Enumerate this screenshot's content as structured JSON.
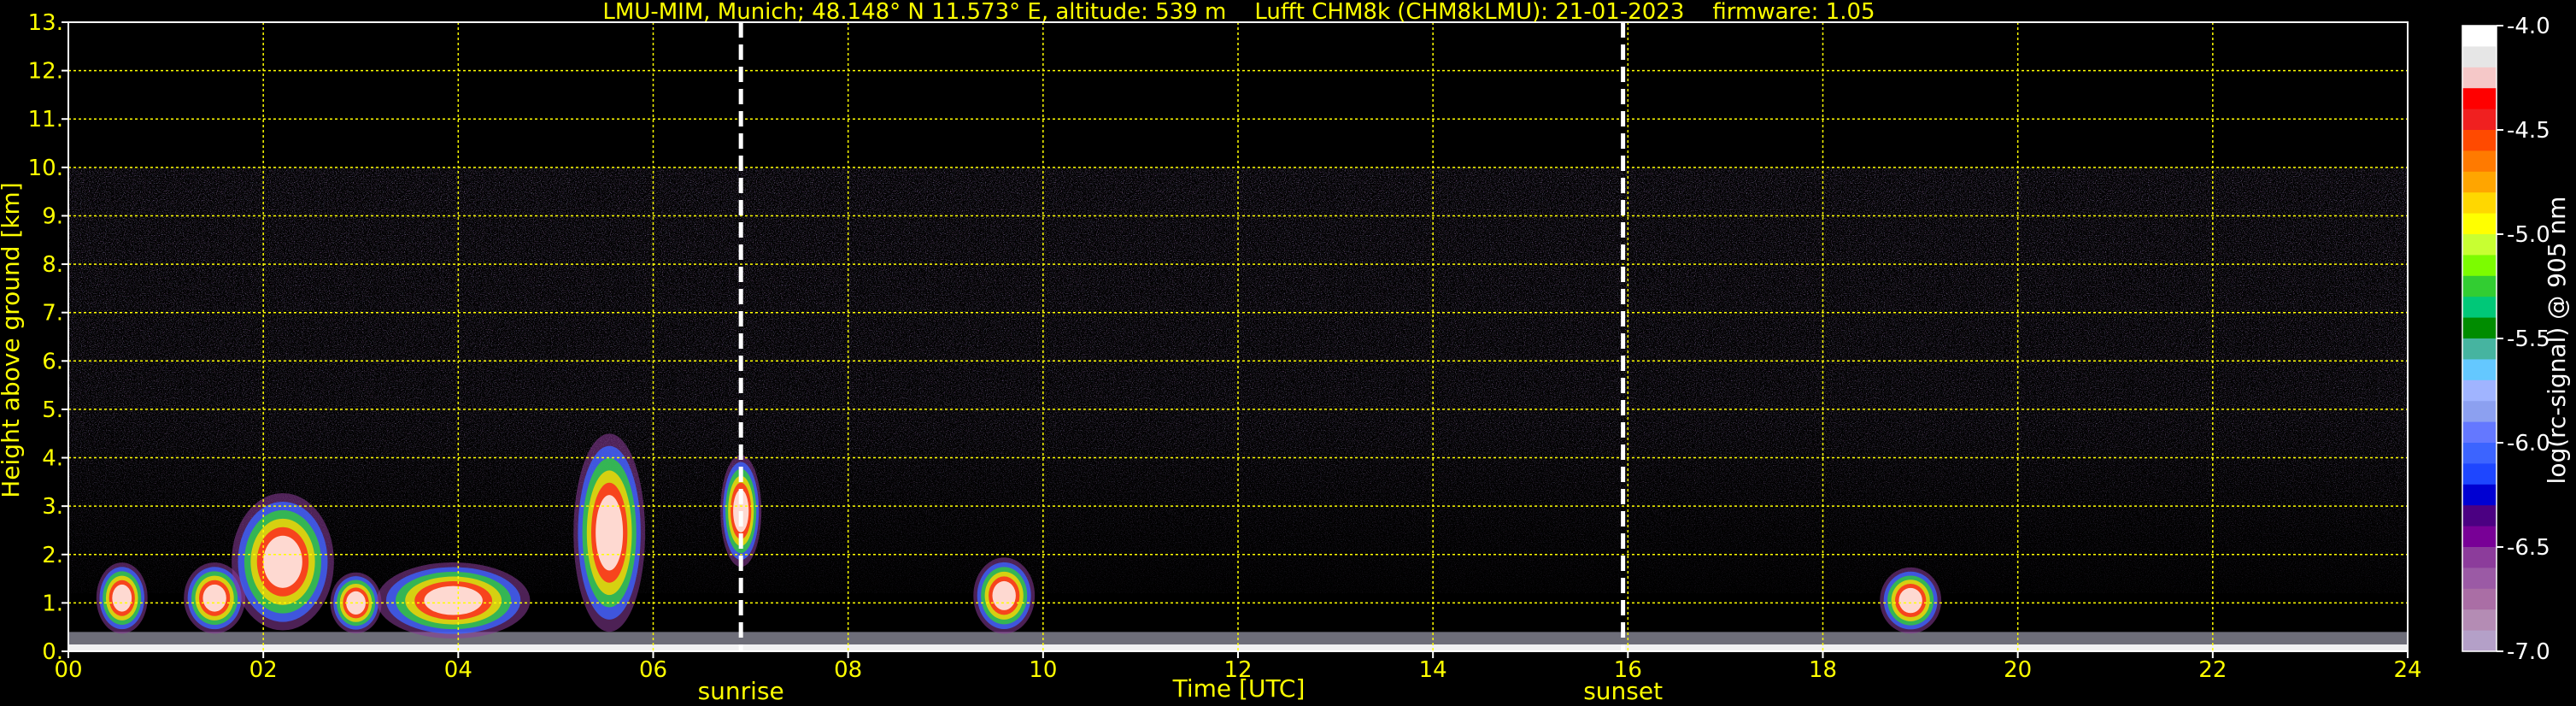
{
  "chart_data": {
    "type": "heatmap",
    "title": "LMU-MIM, Munich; 48.148° N 11.573° E, altitude: 539 m    Lufft CHM8k (CHM8kLMU): 21-01-2023    firmware: 1.05",
    "xlabel": "Time [UTC]",
    "ylabel": "Height above ground [km]",
    "xlim": [
      0,
      24
    ],
    "ylim": [
      0,
      13
    ],
    "xticks": [
      "00",
      "02",
      "04",
      "06",
      "08",
      "10",
      "12",
      "14",
      "16",
      "18",
      "20",
      "22",
      "24"
    ],
    "yticks": [
      "0.",
      "1.",
      "2.",
      "3.",
      "4.",
      "5.",
      "6.",
      "7.",
      "8.",
      "9.",
      "10.",
      "11.",
      "12.",
      "13."
    ],
    "grid": true,
    "annotations": [
      {
        "text": "sunrise",
        "x": 6.9
      },
      {
        "text": "sunset",
        "x": 15.95
      }
    ],
    "colorbar": {
      "label": "log(rc-signal) @ 905 nm",
      "range": [
        -7.0,
        -4.0
      ],
      "ticks": [
        "-4.0",
        "-4.5",
        "-5.0",
        "-5.5",
        "-6.0",
        "-6.5",
        "-7.0"
      ],
      "colors": [
        "#ffffff",
        "#e6e6e6",
        "#f5c8c8",
        "#ff0000",
        "#f02020",
        "#ff4a00",
        "#ff7a00",
        "#ffa500",
        "#ffd700",
        "#ffff00",
        "#c8ff32",
        "#7cfc00",
        "#32cd32",
        "#00c878",
        "#008c00",
        "#46b4a0",
        "#64c8ff",
        "#a0b4ff",
        "#8ca0f0",
        "#6478ff",
        "#3c64ff",
        "#1e46ff",
        "#0000d2",
        "#4b0082",
        "#780096",
        "#8c3c9b",
        "#9b5aa5",
        "#aa6ea5",
        "#b48cb4",
        "#b4a0c8"
      ]
    },
    "noise_top_km": 10.0,
    "features": [
      {
        "name": "aerosol boundary layer",
        "x": [
          0,
          24
        ],
        "y": [
          0,
          0.4
        ]
      },
      {
        "name": "cloud",
        "x": [
          0.3,
          0.8
        ],
        "y": [
          0.4,
          1.8
        ]
      },
      {
        "name": "cloud",
        "x": [
          1.2,
          1.8
        ],
        "y": [
          0.4,
          1.8
        ]
      },
      {
        "name": "cloud",
        "x": [
          1.7,
          2.7
        ],
        "y": [
          0.5,
          3.2
        ]
      },
      {
        "name": "cloud",
        "x": [
          2.7,
          3.2
        ],
        "y": [
          0.4,
          1.6
        ]
      },
      {
        "name": "cloud",
        "x": [
          3.2,
          4.7
        ],
        "y": [
          0.3,
          1.8
        ]
      },
      {
        "name": "cloud",
        "x": [
          5.2,
          5.9
        ],
        "y": [
          0.5,
          4.4
        ]
      },
      {
        "name": "cloud",
        "x": [
          6.7,
          7.1
        ],
        "y": [
          1.8,
          4.0
        ]
      },
      {
        "name": "cloud",
        "x": [
          9.3,
          9.9
        ],
        "y": [
          0.4,
          1.9
        ]
      },
      {
        "name": "cloud",
        "x": [
          18.6,
          19.2
        ],
        "y": [
          0.4,
          1.7
        ]
      }
    ]
  }
}
